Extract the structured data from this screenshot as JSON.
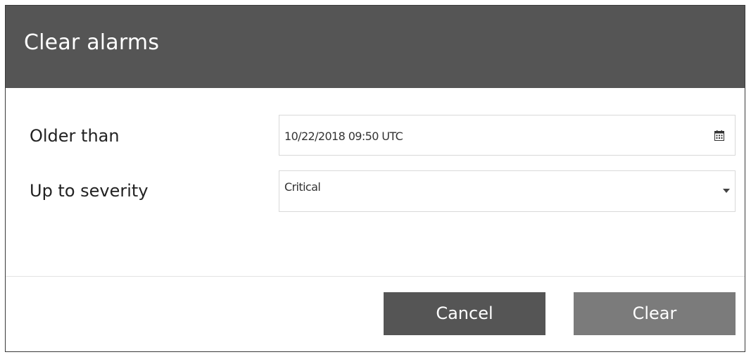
{
  "dialog": {
    "title": "Clear alarms"
  },
  "form": {
    "older_than": {
      "label": "Older than",
      "value": "10/22/2018 09:50 UTC",
      "icon": "calendar-icon"
    },
    "severity": {
      "label": "Up to severity",
      "selected": "Critical",
      "icon": "chevron-down-icon"
    }
  },
  "buttons": {
    "cancel_label": "Cancel",
    "clear_label": "Clear"
  },
  "colors": {
    "header_bg": "#555555",
    "cancel_bg": "#555555",
    "clear_bg": "#7b7b7b",
    "text": "#222222"
  }
}
